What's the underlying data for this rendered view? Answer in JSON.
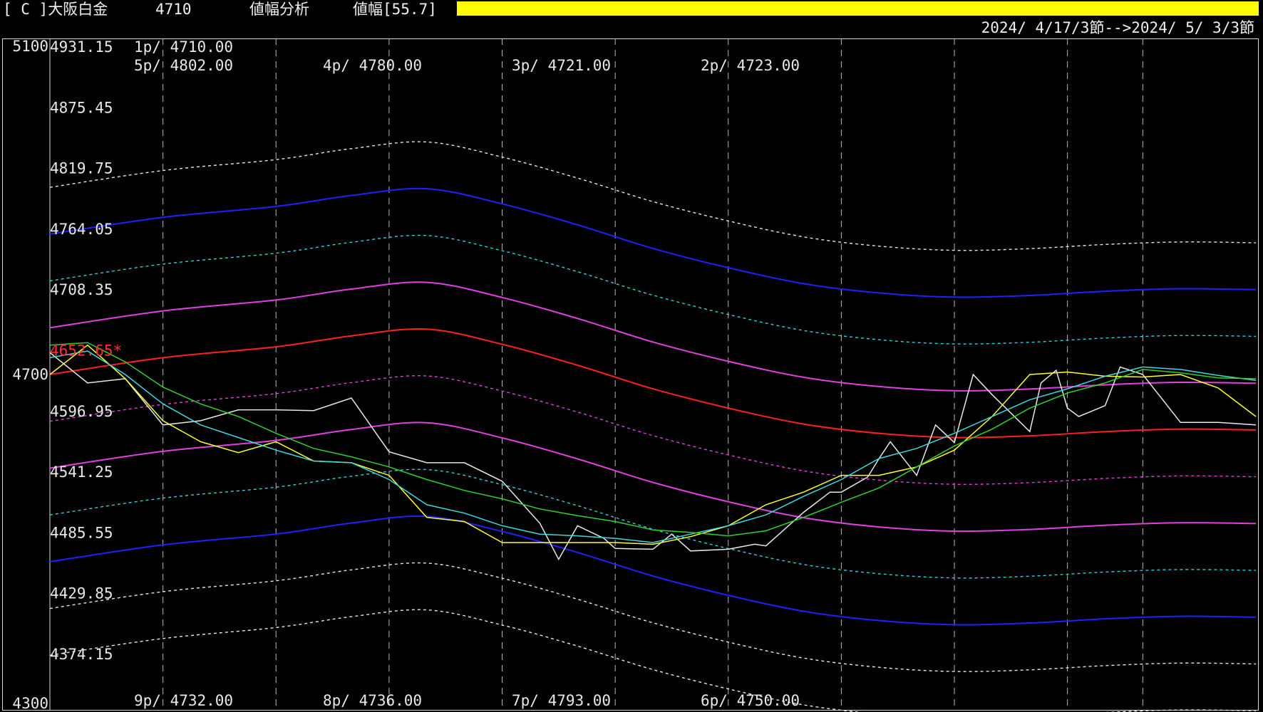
{
  "header": {
    "market": "[ C ]大阪白金",
    "price": "4710",
    "mode": "値幅分析",
    "range_label": "値幅[55.7]",
    "bar_color": "#ffff00",
    "date_range": "2024/ 4/17/3節-->2024/ 5/ 3/3節"
  },
  "chart_data": {
    "type": "line",
    "y_axis_left": [
      "5100",
      "4700",
      "4300"
    ],
    "ylim": [
      4300,
      5100
    ],
    "band_labels": [
      "4931.15",
      "4875.45",
      "4819.75",
      "4764.05",
      "4708.35",
      "4652.65*",
      "4596.95",
      "4541.25",
      "4485.55",
      "4429.85",
      "4374.15"
    ],
    "band_label_colors": [
      "#e8e8e8",
      "#e8e8e8",
      "#e8e8e8",
      "#e8e8e8",
      "#e8e8e8",
      "#ff3030",
      "#e8e8e8",
      "#e8e8e8",
      "#e8e8e8",
      "#e8e8e8",
      "#e8e8e8"
    ],
    "period_labels_top": [
      "1p/ 4710.00",
      "5p/ 4802.00",
      "4p/ 4780.00",
      "3p/ 4721.00",
      "2p/ 4723.00"
    ],
    "period_labels_bottom": [
      "9p/ 4732.00",
      "8p/ 4736.00",
      "7p/ 4793.00",
      "6p/ 4750.00"
    ],
    "vertical_grid_days": [
      3,
      6,
      9,
      12,
      15,
      18,
      21,
      24,
      27,
      29
    ],
    "x_span_days": 32,
    "band_center": {
      "x": [
        0,
        3,
        6,
        8,
        10,
        12,
        14,
        16,
        18,
        20,
        22,
        24,
        26,
        28,
        30,
        32
      ],
      "values": [
        4700,
        4720,
        4733,
        4746,
        4754,
        4736,
        4711,
        4683,
        4660,
        4641,
        4630,
        4625,
        4627,
        4632,
        4635,
        4634
      ]
    },
    "bands": [
      {
        "offset": 222.8,
        "color": "#e8e8e8",
        "dash": true
      },
      {
        "offset": 167.1,
        "color": "#2020ff",
        "dash": false
      },
      {
        "offset": 111.4,
        "color": "#30d0d8",
        "dash": true
      },
      {
        "offset": 55.7,
        "color": "#e040e0",
        "dash": false
      },
      {
        "offset": 0,
        "color": "#ff2020",
        "dash": false
      },
      {
        "offset": -55.7,
        "color": "#e040e0",
        "dash": true
      },
      {
        "offset": -111.4,
        "color": "#e040e0",
        "dash": false
      },
      {
        "offset": -167.1,
        "color": "#30d0d8",
        "dash": true
      },
      {
        "offset": -222.8,
        "color": "#2020ff",
        "dash": false
      },
      {
        "offset": -278.5,
        "color": "#e8e8e8",
        "dash": true
      },
      {
        "offset": -334.2,
        "color": "#e8e8e8",
        "dash": true
      }
    ],
    "series": [
      {
        "color": "#e8e8e8",
        "x": [
          0,
          1,
          2,
          4,
          5,
          6,
          7,
          8,
          9,
          10,
          11,
          12,
          13,
          14,
          15,
          16,
          17,
          18,
          19,
          20,
          21,
          22,
          23,
          24,
          25,
          26,
          27,
          28,
          29,
          30,
          31,
          32
        ],
        "values": [
          4726,
          4690,
          4695,
          4645,
          4658,
          4658,
          4657,
          4672,
          4608,
          4595,
          4595,
          4573,
          4523,
          4520,
          4493,
          4492,
          4490,
          4492,
          4496,
          4536,
          4560,
          4600,
          4580,
          4619,
          4676,
          4632,
          4660,
          4663,
          4700,
          4643,
          4643,
          4640
        ],
        "x_extra": [
          3,
          13.5,
          14.7,
          16.5,
          18.7,
          20.7,
          21.7,
          22.3,
          23.5,
          24.5,
          26.3,
          26.7,
          27.3,
          28.4
        ],
        "values_extra": [
          4640,
          4480,
          4505,
          4510,
          4498,
          4560,
          4578,
          4620,
          4640,
          4700,
          4690,
          4705,
          4650,
          4709
        ]
      },
      {
        "color": "#ffff30",
        "x": [
          0,
          1,
          2,
          3,
          4,
          5,
          6,
          7,
          8,
          9,
          10,
          11,
          12,
          13,
          14,
          15,
          16,
          17,
          18,
          19,
          20,
          21,
          22,
          23,
          24,
          25,
          26,
          27,
          28,
          29,
          30,
          31,
          32
        ],
        "values": [
          4700,
          4735,
          4695,
          4645,
          4620,
          4607,
          4620,
          4597,
          4595,
          4580,
          4530,
          4525,
          4500,
          4500,
          4500,
          4500,
          4498,
          4507,
          4520,
          4545,
          4560,
          4580,
          4580,
          4590,
          4610,
          4650,
          4700,
          4703,
          4698,
          4697,
          4700,
          4684,
          4650
        ]
      },
      {
        "color": "#40d8e0",
        "x": [
          0,
          1,
          2,
          3,
          4,
          5,
          6,
          7,
          8,
          9,
          10,
          11,
          12,
          13,
          14,
          15,
          16,
          17,
          18,
          19,
          20,
          21,
          22,
          23,
          24,
          25,
          26,
          27,
          28,
          29,
          30,
          31,
          32
        ],
        "values": [
          4720,
          4728,
          4700,
          4665,
          4640,
          4625,
          4610,
          4597,
          4595,
          4575,
          4545,
          4535,
          4520,
          4510,
          4508,
          4505,
          4500,
          4510,
          4520,
          4533,
          4555,
          4575,
          4600,
          4612,
          4630,
          4650,
          4670,
          4683,
          4698,
          4709,
          4706,
          4699,
          4693
        ]
      },
      {
        "color": "#30d030",
        "x": [
          0,
          1,
          2,
          3,
          4,
          5,
          6,
          7,
          8,
          9,
          10,
          11,
          12,
          13,
          14,
          15,
          16,
          17,
          18,
          19,
          20,
          21,
          22,
          23,
          24,
          25,
          26,
          27,
          28,
          29,
          30,
          31,
          32
        ],
        "values": [
          4735,
          4738,
          4715,
          4685,
          4665,
          4650,
          4630,
          4612,
          4602,
          4590,
          4575,
          4562,
          4552,
          4540,
          4532,
          4525,
          4515,
          4512,
          4508,
          4514,
          4530,
          4548,
          4565,
          4590,
          4615,
          4635,
          4660,
          4678,
          4690,
          4706,
          4702,
          4696,
          4695
        ]
      }
    ]
  }
}
